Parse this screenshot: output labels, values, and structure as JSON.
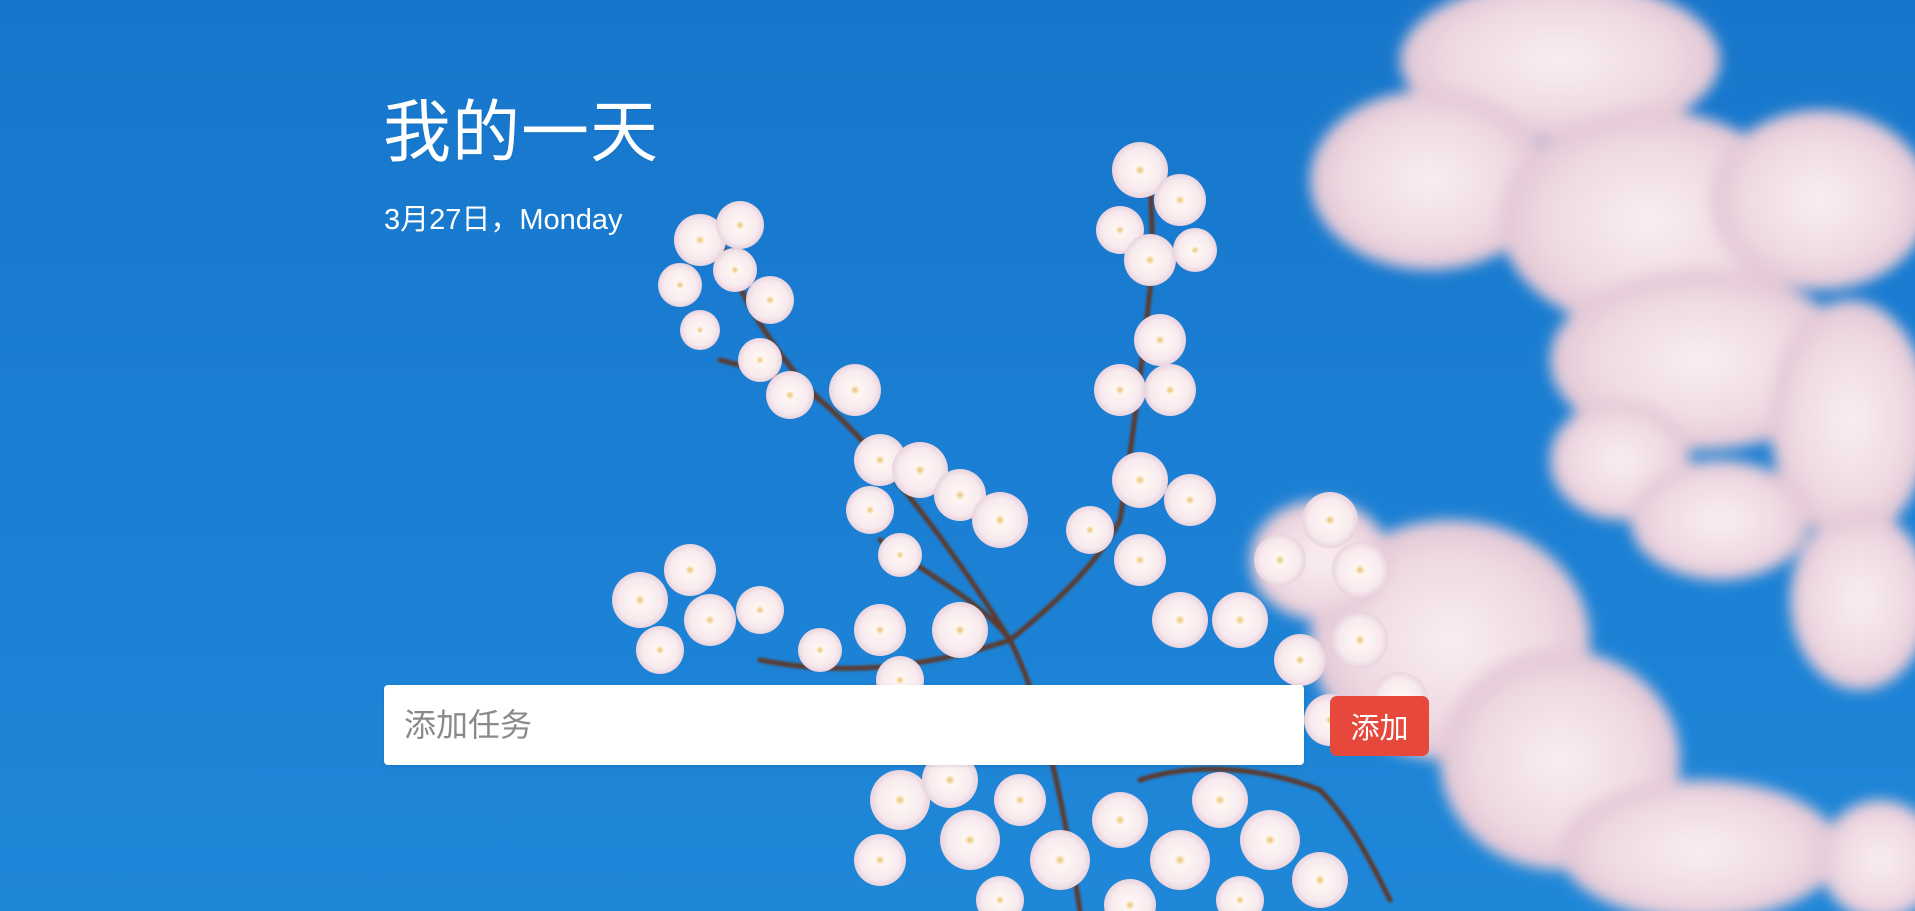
{
  "header": {
    "title": "我的一天",
    "date": "3月27日，Monday"
  },
  "task_form": {
    "placeholder": "添加任务",
    "value": "",
    "add_label": "添加"
  },
  "background": {
    "subject": "cherry blossoms against blue sky",
    "sky_color": "#1a7ed3",
    "blossom_color": "#f6ecef",
    "branch_color": "#5b3b2e"
  },
  "colors": {
    "accent": "#e6493b",
    "text": "#ffffff"
  }
}
